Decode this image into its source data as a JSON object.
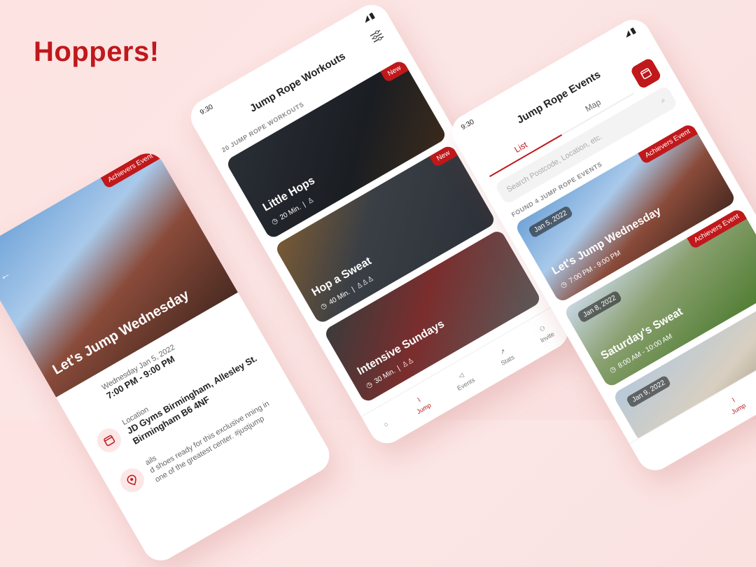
{
  "brand": {
    "title": "Hoppers!"
  },
  "colors": {
    "accent": "#c0181b",
    "background": "#fbe4e3"
  },
  "phone_event_detail": {
    "back_icon": "arrow-left-icon",
    "badge": "Achievers Event",
    "title": "Let's Jump Wednesday",
    "date_label": "Wednesday Jan 5, 2022",
    "time": "7:00 PM - 9:00 PM",
    "location_label": "Location",
    "location_line1": "JD Gyms Birmingham, Allesley St.",
    "location_line2": "Birmingham B6 4NF",
    "details_label": "ails",
    "details_text": "d shoes ready for this exclusive nning in one of the greatest center. #justjump"
  },
  "phone_workouts": {
    "status_time": "9:30",
    "title": "Jump Rope Workouts",
    "count_label": "20 JUMP ROPE WORKOUTS",
    "filter_icon": "sliders-icon",
    "workouts": [
      {
        "title": "Little Hops",
        "duration": "20 Min.",
        "badge": "New",
        "sep": "|"
      },
      {
        "title": "Hop a Sweat",
        "duration": "40 Min.",
        "badge": "New",
        "sep": "|"
      },
      {
        "title": "Intensive Sundays",
        "duration": "30 Min.",
        "badge": "",
        "sep": "|"
      }
    ],
    "tabs": [
      {
        "label": "",
        "icon": "home-icon"
      },
      {
        "label": "Jump",
        "icon": "jump-rope-icon",
        "active": true
      },
      {
        "label": "Events",
        "icon": "megaphone-icon"
      },
      {
        "label": "Stats",
        "icon": "chart-icon"
      },
      {
        "label": "Invite",
        "icon": "invite-icon"
      }
    ]
  },
  "phone_events": {
    "status_time": "9:30",
    "title": "Jump Rope Events",
    "calendar_icon": "calendar-icon",
    "tab_list": "List",
    "tab_map": "Map",
    "search_placeholder": "Search Postcode, Location, etc.",
    "found_label": "FOUND 4 JUMP ROPE EVENTS",
    "events": [
      {
        "date": "Jan 5, 2022",
        "title": "Let's Jump Wednesday",
        "time": "7:00 PM - 9:00 PM",
        "badge": "Achievers Event"
      },
      {
        "date": "Jan 8, 2022",
        "title": "Saturday's Sweat",
        "time": "8:00 AM - 10:00 AM",
        "badge": "Achievers Event"
      },
      {
        "date": "Jan 9, 2022",
        "title": "",
        "time": "",
        "badge": ""
      }
    ],
    "bottom_tab": "Jump"
  }
}
